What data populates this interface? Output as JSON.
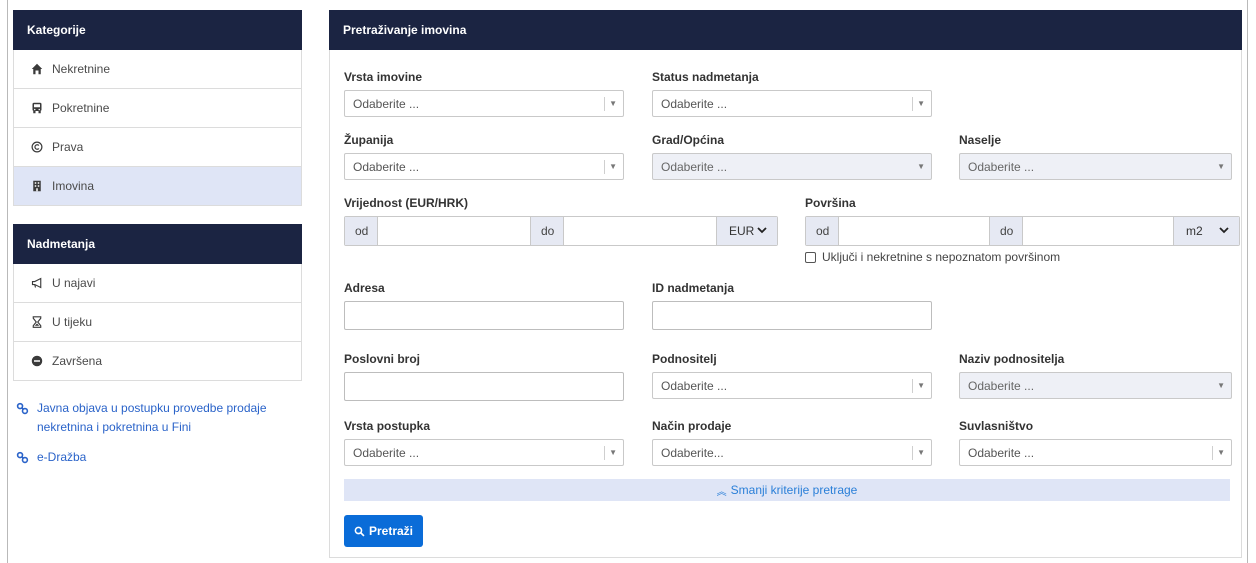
{
  "sidebar": {
    "categories_title": "Kategorije",
    "categories": [
      {
        "label": "Nekretnine",
        "icon": "home-icon"
      },
      {
        "label": "Pokretnine",
        "icon": "bus-icon"
      },
      {
        "label": "Prava",
        "icon": "copyright-icon"
      },
      {
        "label": "Imovina",
        "icon": "building-icon",
        "active": true
      }
    ],
    "auctions_title": "Nadmetanja",
    "auctions": [
      {
        "label": "U najavi",
        "icon": "megaphone-icon"
      },
      {
        "label": "U tijeku",
        "icon": "hourglass-icon"
      },
      {
        "label": "Završena",
        "icon": "minus-circle-icon"
      }
    ],
    "links": [
      {
        "label": "Javna objava u postupku provedbe prodaje nekretnina i pokretnina u Fini",
        "icon": "link-icon"
      },
      {
        "label": "e-Dražba",
        "icon": "link-icon"
      }
    ]
  },
  "main": {
    "title": "Pretraživanje imovina",
    "placeholder": "Odaberite ...",
    "placeholder_nacin": "Odaberite...",
    "fields": {
      "vrsta_imovine": "Vrsta imovine",
      "status_nadmetanja": "Status nadmetanja",
      "zupanija": "Županija",
      "grad_opcina": "Grad/Općina",
      "naselje": "Naselje",
      "vrijednost": "Vrijednost (EUR/HRK)",
      "povrsina": "Površina",
      "adresa": "Adresa",
      "id_nadmetanja": "ID nadmetanja",
      "poslovni_broj": "Poslovni broj",
      "podnositelj": "Podnositelj",
      "naziv_podnositelja": "Naziv podnositelja",
      "vrsta_postupka": "Vrsta postupka",
      "nacin_prodaje": "Način prodaje",
      "suvlasnistvo": "Suvlasništvo"
    },
    "range": {
      "from": "od",
      "to": "do"
    },
    "currency": "EUR",
    "area_unit": "m2",
    "unknown_area_checkbox": "Uključi i nekretnine s nepoznatom površinom",
    "collapse_label": "Smanji kriterije pretrage",
    "search_button": "Pretraži"
  },
  "colors": {
    "header_bg": "#1b2442",
    "active_bg": "#dfe5f6",
    "link": "#2a63c9",
    "primary_button": "#0a6cd8"
  }
}
